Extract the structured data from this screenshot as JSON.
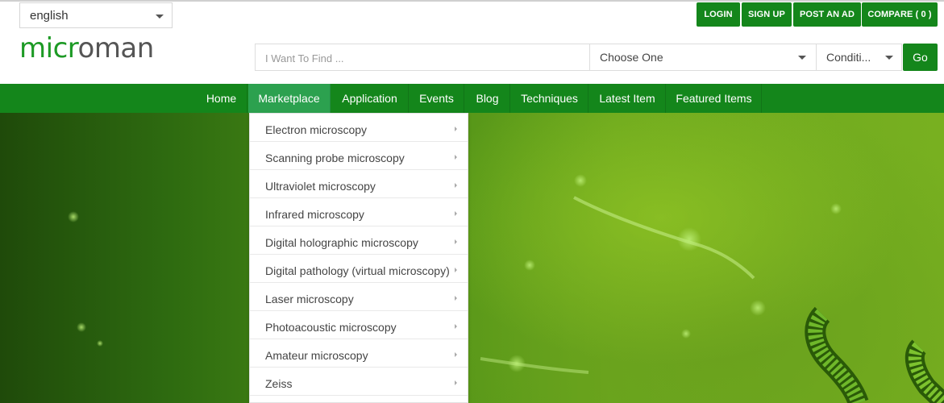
{
  "language": {
    "selected": "english"
  },
  "top_buttons": [
    {
      "label": "LOGIN"
    },
    {
      "label": "SIGN UP"
    },
    {
      "label": "POST AN AD"
    },
    {
      "label": "COMPARE ( 0 )"
    }
  ],
  "logo": {
    "part1": "micr",
    "part2": "o",
    "part3": "man"
  },
  "search": {
    "placeholder": "I Want To Find ...",
    "category_selected": "Choose One",
    "condition_selected": "Conditi...",
    "go_label": "Go"
  },
  "nav": {
    "items": [
      {
        "label": "Home"
      },
      {
        "label": "Marketplace"
      },
      {
        "label": "Application"
      },
      {
        "label": "Events"
      },
      {
        "label": "Blog"
      },
      {
        "label": "Techniques"
      },
      {
        "label": "Latest Item"
      },
      {
        "label": "Featured Items"
      }
    ],
    "active": "Marketplace"
  },
  "marketplace_menu": {
    "items": [
      {
        "label": "Electron microscopy"
      },
      {
        "label": "Scanning probe microscopy"
      },
      {
        "label": "Ultraviolet microscopy"
      },
      {
        "label": "Infrared microscopy"
      },
      {
        "label": "Digital holographic microscopy"
      },
      {
        "label": "Digital pathology (virtual microscopy)"
      },
      {
        "label": "Laser microscopy"
      },
      {
        "label": "Photoacoustic microscopy"
      },
      {
        "label": "Amateur microscopy"
      },
      {
        "label": "Zeiss"
      }
    ]
  },
  "colors": {
    "brand_green": "#14861b",
    "active_nav": "#2ca14f",
    "logo_green": "#1d9a25",
    "logo_gray": "#555555"
  }
}
